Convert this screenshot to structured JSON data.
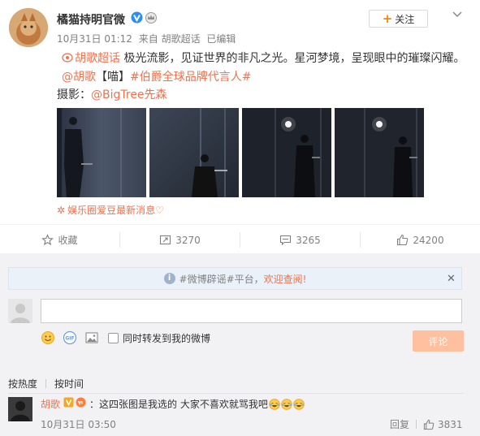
{
  "post": {
    "username": "橘猫持明官微",
    "time": "10月31日 01:12",
    "source": "来自 胡歌超话",
    "edited": "已编辑",
    "follow_label": "关注",
    "text": {
      "topic": "胡歌超话",
      "body1": " 极光流影，见证世界的非凡之光。星河梦境，呈现眼中的璀璨闪耀。 ",
      "mention": "@胡歌",
      "bracket": "【喵】",
      "hashtag": "#伯爵全球品牌代言人#"
    },
    "photo_credit_label": "摄影：",
    "photo_credit_user": "@BigTree先森",
    "source_tag": "娱乐圈爱豆最新消息♡"
  },
  "actions": {
    "favorite": "收藏",
    "repost": "3270",
    "comment": "3265",
    "like": "24200"
  },
  "comments_area": {
    "notice_prefix": "#微博辟谣#平台，",
    "notice_highlight": "欢迎查阅!",
    "forward_label": "同时转发到我的微博",
    "submit_label": "评论",
    "sort_hot": "按热度",
    "sort_time": "按时间"
  },
  "comment": {
    "user": "胡歌",
    "text": "：这四张图是我选的 大家不喜欢就骂我吧",
    "time": "10月31日 03:50",
    "reply_label": "回复",
    "likes": "3831"
  },
  "colors": {
    "accent": "#eb7350",
    "follow_plus": "#ff8200",
    "submit_bg": "#ffc09f",
    "panel_bg": "#f2f2f5"
  },
  "icons": [
    "v-verified-icon",
    "crown-icon",
    "chevron-down-icon",
    "camera-icon",
    "star-icon",
    "repost-icon",
    "comment-icon",
    "thumbs-up-icon",
    "info-icon",
    "close-icon",
    "emoji-icon",
    "gif-icon",
    "image-icon",
    "laugh-cry-emoji"
  ]
}
